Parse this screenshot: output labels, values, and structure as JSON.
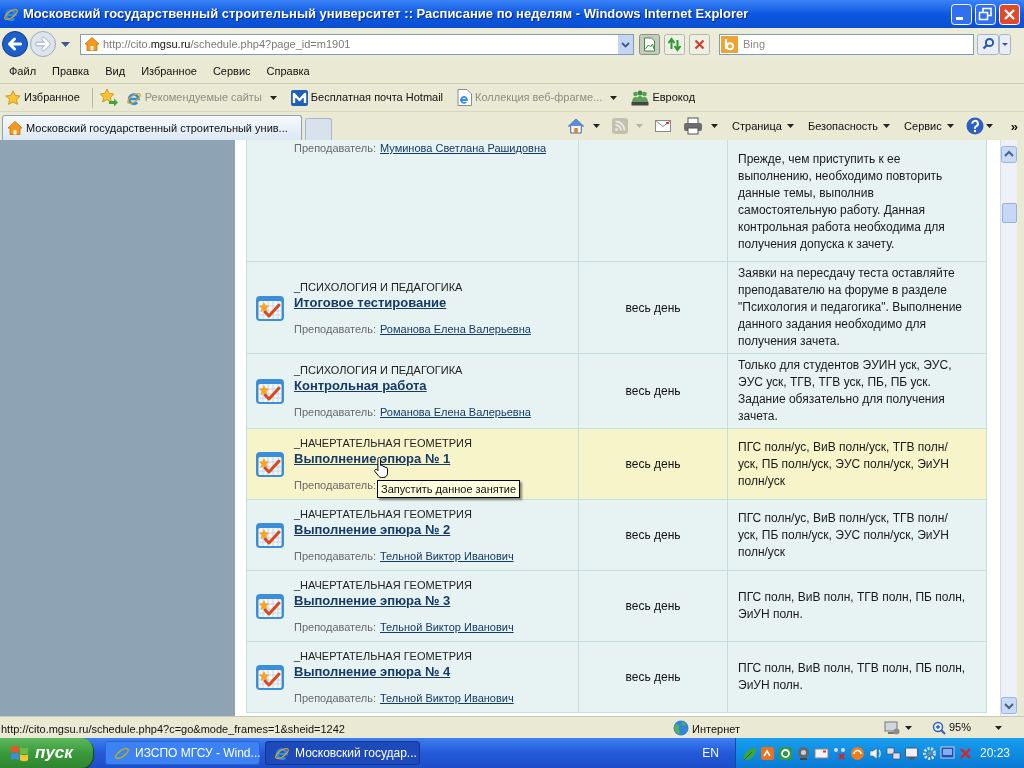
{
  "window": {
    "title": "Московский государственный строительный университет :: Расписание по неделям - Windows Internet Explorer"
  },
  "address_bar": {
    "url": [
      {
        "kind": "dim",
        "text": "http://cito."
      },
      {
        "kind": "domain",
        "text": "mgsu.ru"
      },
      {
        "kind": "dim",
        "text": "/schedule.php4?page_id=m1901"
      }
    ]
  },
  "search": {
    "placeholder": "Bing"
  },
  "menu": [
    "Файл",
    "Правка",
    "Вид",
    "Избранное",
    "Сервис",
    "Справка"
  ],
  "favorites_bar": {
    "favorites": "Избранное",
    "links": [
      {
        "kind": "ie",
        "label": "Рекомендуемые сайты",
        "dimmed": true,
        "dropdown": true
      },
      {
        "kind": "hotmail",
        "label": "Бесплатная почта Hotmail",
        "dimmed": false,
        "dropdown": false
      },
      {
        "kind": "webslice",
        "label": "Коллекция веб-фрагме...",
        "dimmed": true,
        "dropdown": true
      },
      {
        "kind": "app",
        "label": "Еврокод",
        "dimmed": false,
        "dropdown": false
      }
    ]
  },
  "tabs": [
    {
      "label": "Московский государственный строительный унив...",
      "selected": true
    }
  ],
  "command_bar": {
    "buttons": [
      {
        "kind": "home",
        "dropdown": true,
        "disabled": false
      },
      {
        "kind": "feeds",
        "dropdown": true,
        "disabled": true
      },
      {
        "kind": "mail",
        "dropdown": false,
        "disabled": false
      },
      {
        "kind": "print",
        "dropdown": true,
        "disabled": false
      }
    ],
    "menus": [
      "Страница",
      "Безопасность",
      "Сервис"
    ],
    "overflow": "»"
  },
  "schedule_rows": [
    {
      "kind": "continued",
      "teacher_label": "Преподаватель:",
      "teacher": "Муминова Светлана Рашидовна",
      "note": "Прежде, чем приступить к ее выполнению, необходимо повторить данные темы, выполнив самостоятельную работу. Данная контрольная работа необходима для получения допуска к зачету.",
      "highlighted": false
    },
    {
      "kind": "full",
      "category": "_ПСИХОЛОГИЯ И ПЕДАГОГИКА",
      "title": "Итоговое тестирование",
      "teacher_label": "Преподаватель:",
      "teacher": "Романова Елена Валерьевна",
      "time": "весь день",
      "note": "Заявки на пересдачу теста оставляйте преподавателю на форуме в разделе \"Психология и педагогика\". Выполнение данного задания необходимо для получения зачета.",
      "highlighted": false
    },
    {
      "kind": "full",
      "category": "_ПСИХОЛОГИЯ И ПЕДАГОГИКА",
      "title": "Контрольная работа",
      "teacher_label": "Преподаватель:",
      "teacher": "Романова Елена Валерьевна",
      "time": "весь день",
      "note": "Только для студентов ЭУИН уск, ЭУС, ЭУС уск, ТГВ, ТГВ уск, ПБ, ПБ уск. Задание обязательно для получения зачета.",
      "highlighted": false
    },
    {
      "kind": "full",
      "category": "_НАЧЕРТАТЕЛЬНАЯ ГЕОМЕТРИЯ",
      "title": "Выполнение эпюра № 1",
      "teacher_label": "Преподаватель:",
      "time": "весь день",
      "note": "ПГС полн/ус, ВиВ полн/уск, ТГВ полн/уск, ПБ полн/уск, ЭУС полн/уск, ЭиУН полн/уск",
      "highlighted": true,
      "tooltip": "Запустить данное занятие"
    },
    {
      "kind": "full",
      "category": "_НАЧЕРТАТЕЛЬНАЯ ГЕОМЕТРИЯ",
      "title": "Выполнение эпюра № 2",
      "teacher_label": "Преподаватель:",
      "teacher": "Тельной Виктор Иванович",
      "time": "весь день",
      "note": "ПГС полн/ус, ВиВ полн/уск, ТГВ полн/уск, ПБ полн/уск, ЭУС полн/уск, ЭиУН полн/уск",
      "highlighted": false
    },
    {
      "kind": "full",
      "category": "_НАЧЕРТАТЕЛЬНАЯ ГЕОМЕТРИЯ",
      "title": "Выполнение эпюра № 3",
      "teacher_label": "Преподаватель:",
      "teacher": "Тельной Виктор Иванович",
      "time": "весь день",
      "note": "ПГС полн, ВиВ полн, ТГВ полн, ПБ полн, ЭиУН полн.",
      "highlighted": false
    },
    {
      "kind": "full",
      "category": "_НАЧЕРТАТЕЛЬНАЯ ГЕОМЕТРИЯ",
      "title": "Выполнение эпюра № 4",
      "teacher_label": "Преподаватель:",
      "teacher": "Тельной Виктор Иванович",
      "time": "весь день",
      "note": "ПГС полн, ВиВ полн, ТГВ полн, ПБ полн, ЭиУН полн.",
      "highlighted": false
    }
  ],
  "status_bar": {
    "url": "http://cito.mgsu.ru/schedule.php4?c=go&mode_frames=1&sheid=1242",
    "zone": "Интернет",
    "zoom": "95%"
  },
  "taskbar": {
    "start": "пуск",
    "tasks": [
      {
        "label": "ИЗСПО МГСУ - Wind...",
        "selected": false
      },
      {
        "label": "Московский государ...",
        "selected": true
      }
    ],
    "language": "EN",
    "clock": "20:23"
  }
}
